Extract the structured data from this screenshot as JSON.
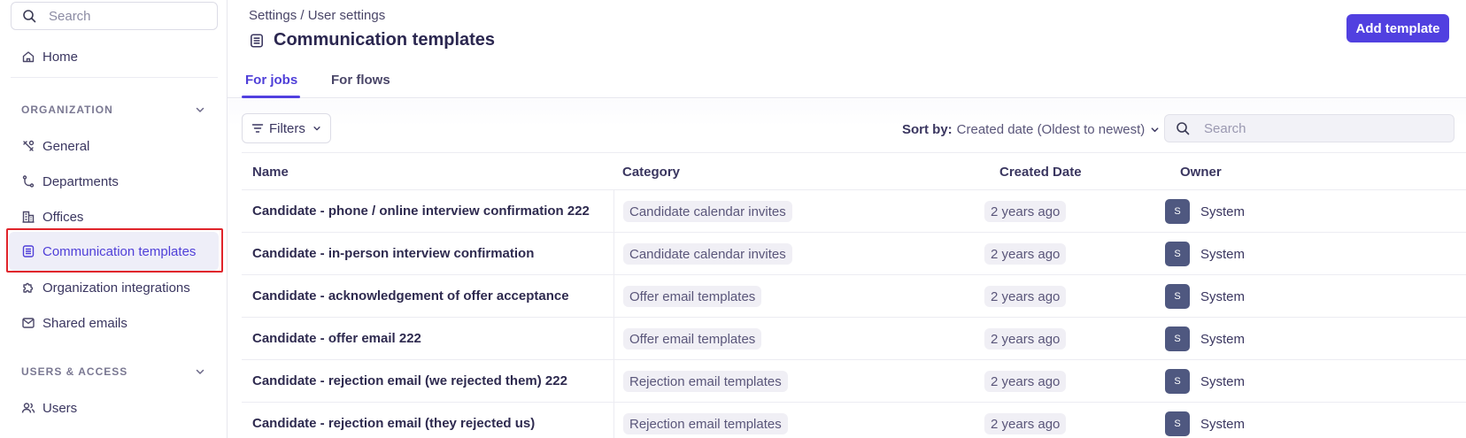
{
  "sidebar": {
    "search_placeholder": "Search",
    "home_label": "Home",
    "organization_label": "ORGANIZATION",
    "items": [
      {
        "label": "General"
      },
      {
        "label": "Departments"
      },
      {
        "label": "Offices"
      },
      {
        "label": "Communication templates"
      },
      {
        "label": "Organization integrations"
      },
      {
        "label": "Shared emails"
      }
    ],
    "users_access_label": "USERS & ACCESS",
    "users_label": "Users"
  },
  "header": {
    "breadcrumb": "Settings / User settings",
    "title": "Communication templates",
    "add_button": "Add template"
  },
  "tabs": [
    {
      "label": "For jobs"
    },
    {
      "label": "For flows"
    }
  ],
  "toolbar": {
    "filters_label": "Filters",
    "sort_label": "Sort by:",
    "sort_value": "Created date (Oldest to newest)",
    "search_placeholder": "Search"
  },
  "table": {
    "columns": [
      "Name",
      "Category",
      "Created Date",
      "Owner"
    ],
    "rows": [
      {
        "name": "Candidate - phone / online interview confirmation 222",
        "category": "Candidate calendar invites",
        "created": "2 years ago",
        "owner_initial": "S",
        "owner": "System"
      },
      {
        "name": "Candidate - in-person interview confirmation",
        "category": "Candidate calendar invites",
        "created": "2 years ago",
        "owner_initial": "S",
        "owner": "System"
      },
      {
        "name": "Candidate - acknowledgement of offer acceptance",
        "category": "Offer email templates",
        "created": "2 years ago",
        "owner_initial": "S",
        "owner": "System"
      },
      {
        "name": "Candidate - offer email 222",
        "category": "Offer email templates",
        "created": "2 years ago",
        "owner_initial": "S",
        "owner": "System"
      },
      {
        "name": "Candidate - rejection email (we rejected them) 222",
        "category": "Rejection email templates",
        "created": "2 years ago",
        "owner_initial": "S",
        "owner": "System"
      },
      {
        "name": "Candidate - rejection email (they rejected us)",
        "category": "Rejection email templates",
        "created": "2 years ago",
        "owner_initial": "S",
        "owner": "System"
      }
    ]
  },
  "colors": {
    "accent": "#5140e0",
    "highlight_outline": "#e0242b",
    "avatar_bg": "#4f5880"
  }
}
